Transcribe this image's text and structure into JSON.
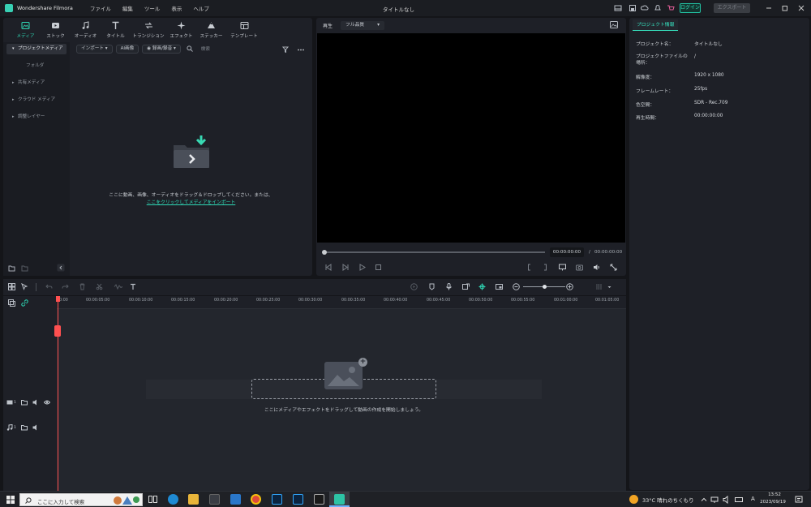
{
  "app": {
    "name": "Wondershare Filmora",
    "document_title": "タイトルなし"
  },
  "menu": [
    "ファイル",
    "編集",
    "ツール",
    "表示",
    "ヘルプ"
  ],
  "header_buttons": {
    "login": "ログイン",
    "export": "エクスポート"
  },
  "media_tabs": [
    {
      "label": "メディア",
      "icon": "media-icon",
      "active": true
    },
    {
      "label": "ストック",
      "icon": "stock-icon"
    },
    {
      "label": "オーディオ",
      "icon": "music-note-icon"
    },
    {
      "label": "タイトル",
      "icon": "title-T-icon"
    },
    {
      "label": "トランジション",
      "icon": "transition-icon"
    },
    {
      "label": "エフェクト",
      "icon": "effect-sparkle-icon"
    },
    {
      "label": "ステッカー",
      "icon": "sticker-icon"
    },
    {
      "label": "テンプレート",
      "icon": "template-icon"
    }
  ],
  "sidebar": {
    "project_media": "プロジェクトメディア",
    "folder": "フォルダ",
    "items": [
      "共有メディア",
      "クラウド メディア",
      "調整レイヤー"
    ]
  },
  "media_toolbar": {
    "import": "インポート",
    "ai_image": "AI画像",
    "filter": "録画/録音",
    "search_placeholder": "検索"
  },
  "empty_media": {
    "message": "ここに動画、画像、オーディオをドラッグ＆ドロップしてください。または、",
    "link": "ここをクリックしてメディアをインポート"
  },
  "preview": {
    "label": "再生",
    "quality": "フル品質",
    "current_time": "00:00:00:00",
    "separator": "/",
    "total_time": "00:00:00:00"
  },
  "project_info": {
    "tab": "プロジェクト情報",
    "rows": [
      {
        "label": "プロジェクト名：",
        "value": "タイトルなし"
      },
      {
        "label": "プロジェクトファイルの場所：",
        "value": "/"
      },
      {
        "label": "解像度：",
        "value": "1920 x 1080"
      },
      {
        "label": "フレームレート：",
        "value": "25fps"
      },
      {
        "label": "色空間：",
        "value": "SDR - Rec.709"
      },
      {
        "label": "再生時間：",
        "value": "00:00:00:00"
      }
    ]
  },
  "timeline": {
    "ruler": [
      "00:00",
      "00:00:05:00",
      "00:00:10:00",
      "00:00:15:00",
      "00:00:20:00",
      "00:00:25:00",
      "00:00:30:00",
      "00:00:35:00",
      "00:00:40:00",
      "00:00:45:00",
      "00:00:50:00",
      "00:00:55:00",
      "00:01:00:00",
      "00:01:05:00"
    ],
    "drop_text": "ここにメディアやエフェクトをドラッグして動画の作成を開始しましょう。",
    "tracks": [
      {
        "index": "1",
        "type": "video"
      },
      {
        "index": "1",
        "type": "audio"
      }
    ]
  },
  "taskbar": {
    "search_placeholder": "ここに入力して検索",
    "weather": "33°C  晴れのちくもり",
    "ime": "A",
    "time": "13:52",
    "date": "2023/09/19"
  },
  "colors": {
    "accent": "#2fd9b6",
    "playhead": "#ff5050",
    "panel": "#1e2027"
  }
}
